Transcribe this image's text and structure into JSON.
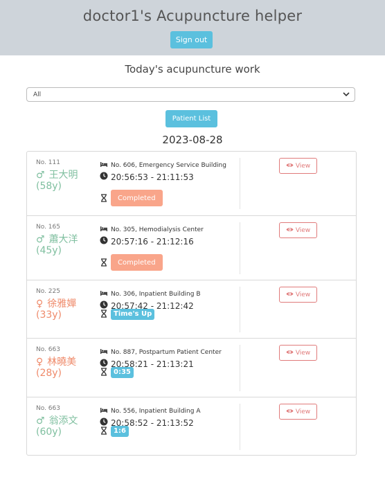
{
  "header": {
    "title": "doctor1's Acupuncture helper",
    "sign_out_label": "Sign out"
  },
  "page": {
    "section_title": "Today's acupuncture work",
    "filter_value": "All",
    "patient_list_label": "Patient List",
    "date": "2023-08-28"
  },
  "colors": {
    "header_bg": "#ced4da",
    "accent": "#5bc0de",
    "male": "#7fbf9f",
    "female": "#ef8a6a",
    "completed": "#f9a58a",
    "view": "#e07a7a"
  },
  "appointments": [
    {
      "no": "No. 111",
      "gender": "male",
      "name": "王大明",
      "age": "(58y)",
      "location": "No. 606, Emergency Service Building",
      "time": "20:56:53 - 21:11:53",
      "status_type": "completed",
      "status": "Completed",
      "view_label": "View"
    },
    {
      "no": "No. 165",
      "gender": "male",
      "name": "蕭大洋",
      "age": "(45y)",
      "location": "No. 305, Hemodialysis Center",
      "time": "20:57:16 - 21:12:16",
      "status_type": "completed",
      "status": "Completed",
      "view_label": "View"
    },
    {
      "no": "No. 225",
      "gender": "female",
      "name": "徐雅嬋",
      "age": "(33y)",
      "location": "No. 306, Inpatient Building B",
      "time": "20:57:42 - 21:12:42",
      "status_type": "info",
      "status": "Time's Up",
      "view_label": "View"
    },
    {
      "no": "No. 663",
      "gender": "female",
      "name": "林曉美",
      "age": "(28y)",
      "location": "No. 887, Postpartum Patient Center",
      "time": "20:58:21 - 21:13:21",
      "status_type": "info",
      "status": "0:35",
      "view_label": "View"
    },
    {
      "no": "No. 663",
      "gender": "male",
      "name": "翁添文",
      "age": "(60y)",
      "location": "No. 556, Inpatient Building A",
      "time": "20:58:52 - 21:13:52",
      "status_type": "info",
      "status": "1:6",
      "view_label": "View"
    }
  ]
}
